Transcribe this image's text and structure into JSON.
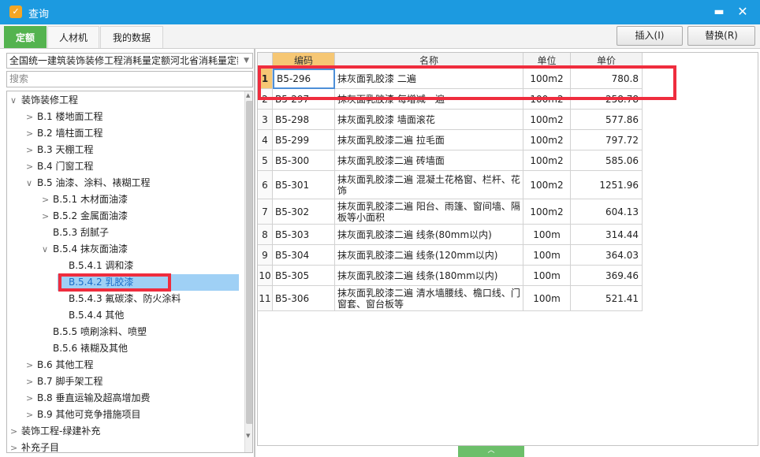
{
  "window": {
    "title": "查询",
    "minimize": "▬",
    "close": "✕"
  },
  "tabs": [
    {
      "label": "定额",
      "active": true
    },
    {
      "label": "人材机",
      "active": false
    },
    {
      "label": "我的数据",
      "active": false
    }
  ],
  "toolbar": {
    "insert_label": "插入(I)",
    "replace_label": "替换(R)"
  },
  "library": {
    "selected": "全国统一建筑装饰装修工程消耗量定额河北省消耗量定额"
  },
  "search": {
    "placeholder": "搜索"
  },
  "tree": [
    {
      "label": "装饰装修工程",
      "level": 0,
      "chevron": "∨"
    },
    {
      "label": "B.1 楼地面工程",
      "level": 1,
      "chevron": ">"
    },
    {
      "label": "B.2 墙柱面工程",
      "level": 1,
      "chevron": ">"
    },
    {
      "label": "B.3 天棚工程",
      "level": 1,
      "chevron": ">"
    },
    {
      "label": "B.4 门窗工程",
      "level": 1,
      "chevron": ">"
    },
    {
      "label": "B.5 油漆、涂料、裱糊工程",
      "level": 1,
      "chevron": "∨"
    },
    {
      "label": "B.5.1 木材面油漆",
      "level": 2,
      "chevron": ">"
    },
    {
      "label": "B.5.2 金属面油漆",
      "level": 2,
      "chevron": ">"
    },
    {
      "label": "B.5.3 刮腻子",
      "level": 2,
      "chevron": ""
    },
    {
      "label": "B.5.4 抹灰面油漆",
      "level": 2,
      "chevron": "∨"
    },
    {
      "label": "B.5.4.1 调和漆",
      "level": 3,
      "chevron": ""
    },
    {
      "label": "B.5.4.2 乳胶漆",
      "level": 3,
      "chevron": "",
      "selected": true
    },
    {
      "label": "B.5.4.3 氟碳漆、防火涂料",
      "level": 3,
      "chevron": ""
    },
    {
      "label": "B.5.4.4 其他",
      "level": 3,
      "chevron": ""
    },
    {
      "label": "B.5.5 喷刷涂料、喷塑",
      "level": 2,
      "chevron": ""
    },
    {
      "label": "B.5.6 裱糊及其他",
      "level": 2,
      "chevron": ""
    },
    {
      "label": "B.6 其他工程",
      "level": 1,
      "chevron": ">"
    },
    {
      "label": "B.7 脚手架工程",
      "level": 1,
      "chevron": ">"
    },
    {
      "label": "B.8 垂直运输及超高增加费",
      "level": 1,
      "chevron": ">"
    },
    {
      "label": "B.9 其他可竞争措施项目",
      "level": 1,
      "chevron": ">"
    },
    {
      "label": "装饰工程-绿建补充",
      "level": 0,
      "chevron": ">"
    },
    {
      "label": "补充子目",
      "level": 0,
      "chevron": ">"
    }
  ],
  "grid": {
    "headers": [
      "",
      "编码",
      "名称",
      "单位",
      "单价"
    ],
    "rows": [
      {
        "num": "1",
        "code": "B5-296",
        "name": "抹灰面乳胶漆 二遍",
        "unit": "100m2",
        "price": "780.8"
      },
      {
        "num": "2",
        "code": "B5-297",
        "name": "抹灰面乳胶漆 每增减一遍",
        "unit": "100m2",
        "price": "258.78"
      },
      {
        "num": "3",
        "code": "B5-298",
        "name": "抹灰面乳胶漆 墙面滚花",
        "unit": "100m2",
        "price": "577.86"
      },
      {
        "num": "4",
        "code": "B5-299",
        "name": "抹灰面乳胶漆二遍 拉毛面",
        "unit": "100m2",
        "price": "797.72"
      },
      {
        "num": "5",
        "code": "B5-300",
        "name": "抹灰面乳胶漆二遍 砖墙面",
        "unit": "100m2",
        "price": "585.06"
      },
      {
        "num": "6",
        "code": "B5-301",
        "name": "抹灰面乳胶漆二遍 混凝土花格窗、栏杆、花饰",
        "unit": "100m2",
        "price": "1251.96"
      },
      {
        "num": "7",
        "code": "B5-302",
        "name": "抹灰面乳胶漆二遍 阳台、雨篷、窗间墙、隔板等小面积",
        "unit": "100m2",
        "price": "604.13"
      },
      {
        "num": "8",
        "code": "B5-303",
        "name": "抹灰面乳胶漆二遍 线条(80mm以内)",
        "unit": "100m",
        "price": "314.44"
      },
      {
        "num": "9",
        "code": "B5-304",
        "name": "抹灰面乳胶漆二遍 线条(120mm以内)",
        "unit": "100m",
        "price": "364.03"
      },
      {
        "num": "10",
        "code": "B5-305",
        "name": "抹灰面乳胶漆二遍 线条(180mm以内)",
        "unit": "100m",
        "price": "369.46"
      },
      {
        "num": "11",
        "code": "B5-306",
        "name": "抹灰面乳胶漆二遍 清水墙腰线、檐口线、门窗套、窗台板等",
        "unit": "100m",
        "price": "521.41"
      }
    ]
  },
  "icons": {
    "app": "app-icon",
    "chevron_right": "chevron-right-icon",
    "chevron_down": "chevron-down-icon",
    "dropdown": "dropdown-arrow-icon"
  },
  "colors": {
    "titlebar": "#1c9ae0",
    "active_tab": "#54b34f",
    "header_highlight": "#f6c774",
    "selection": "#9fd0f5",
    "annotation": "#ef2d3e"
  }
}
